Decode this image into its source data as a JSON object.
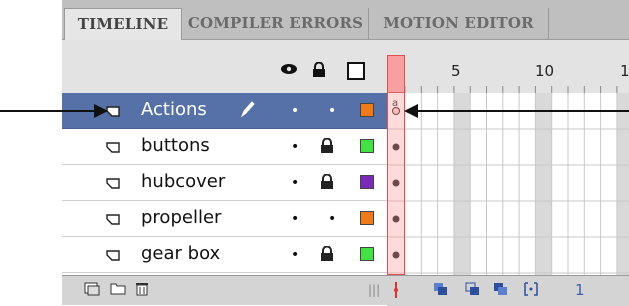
{
  "tabs": [
    {
      "label": "TIMELINE",
      "active": true
    },
    {
      "label": "COMPILER ERRORS",
      "active": false
    },
    {
      "label": "MOTION EDITOR",
      "active": false
    }
  ],
  "header": {
    "icons": [
      "eye-icon",
      "lock-icon",
      "outline-icon"
    ]
  },
  "ruler": {
    "labels": [
      "1",
      "5",
      "10",
      "1"
    ]
  },
  "layers": [
    {
      "name": "Actions",
      "selected": true,
      "locked": false,
      "color": "#f07a1a",
      "keyframe": "hollow"
    },
    {
      "name": "buttons",
      "selected": false,
      "locked": true,
      "color": "#44e044",
      "keyframe": "filled"
    },
    {
      "name": "hubcover",
      "selected": false,
      "locked": true,
      "color": "#7a2cb8",
      "keyframe": "filled"
    },
    {
      "name": "propeller",
      "selected": false,
      "locked": false,
      "color": "#f07a1a",
      "keyframe": "filled"
    },
    {
      "name": "gear box",
      "selected": false,
      "locked": true,
      "color": "#44e044",
      "keyframe": "filled"
    }
  ],
  "bottom": {
    "tools": [
      "new-layer-icon",
      "new-folder-icon",
      "trash-icon"
    ],
    "frame_tools": [
      "center-frame-icon",
      "onion-skin-icon",
      "onion-skin-outlines-icon",
      "edit-multiple-frames-icon",
      "modify-markers-icon"
    ],
    "current_frame": "1"
  },
  "colors": {
    "selected_row": "#5671a8",
    "playhead": "#e05050",
    "tab_bg": "#bfbfbf"
  }
}
